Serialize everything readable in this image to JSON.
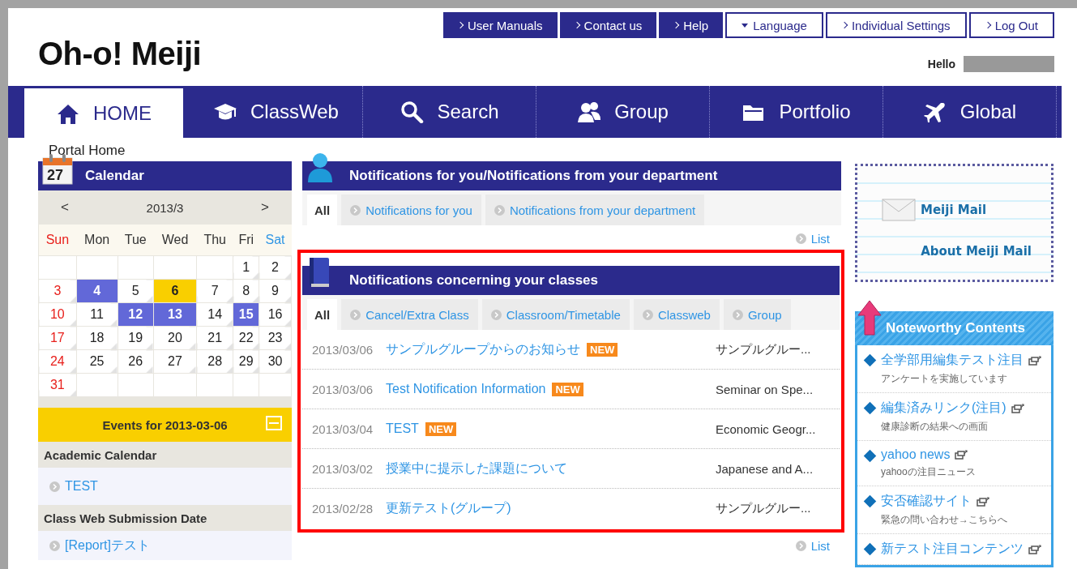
{
  "header": {
    "logo": "Oh-o! Meiji",
    "top_links": [
      {
        "label": "User Manuals",
        "kind": "link"
      },
      {
        "label": "Contact us",
        "kind": "link"
      },
      {
        "label": "Help",
        "kind": "link"
      },
      {
        "label": "Language",
        "kind": "dropdown"
      },
      {
        "label": "Individual Settings",
        "kind": "link"
      },
      {
        "label": "Log Out",
        "kind": "link"
      }
    ],
    "greeting": "Hello"
  },
  "nav": [
    {
      "label": "HOME",
      "selected": true
    },
    {
      "label": "ClassWeb",
      "selected": false
    },
    {
      "label": "Search",
      "selected": false
    },
    {
      "label": "Group",
      "selected": false
    },
    {
      "label": "Portfolio",
      "selected": false
    },
    {
      "label": "Global",
      "selected": false
    }
  ],
  "breadcrumb": "Portal Home",
  "calendar": {
    "icon_day": "27",
    "title": "Calendar",
    "prev": "<",
    "month": "2013/3",
    "next": ">",
    "weekdays": [
      "Sun",
      "Mon",
      "Tue",
      "Wed",
      "Thu",
      "Fri",
      "Sat"
    ],
    "weeks": [
      [
        {
          "kind": "blank"
        },
        {
          "kind": "blank"
        },
        {
          "kind": "blank"
        },
        {
          "kind": "blank"
        },
        {
          "kind": "blank"
        },
        {
          "kind": "day",
          "day": "1",
          "has_event": false,
          "selected": false
        },
        {
          "kind": "day",
          "day": "2",
          "has_event": false,
          "selected": false
        }
      ],
      [
        {
          "kind": "day",
          "day": "3",
          "has_event": false,
          "selected": false
        },
        {
          "kind": "day",
          "day": "4",
          "has_event": true,
          "selected": false
        },
        {
          "kind": "day",
          "day": "5",
          "has_event": false,
          "selected": false
        },
        {
          "kind": "day",
          "day": "6",
          "has_event": true,
          "selected": true
        },
        {
          "kind": "day",
          "day": "7",
          "has_event": false,
          "selected": false
        },
        {
          "kind": "day",
          "day": "8",
          "has_event": false,
          "selected": false
        },
        {
          "kind": "day",
          "day": "9",
          "has_event": false,
          "selected": false
        }
      ],
      [
        {
          "kind": "day",
          "day": "10",
          "has_event": false,
          "selected": false
        },
        {
          "kind": "day",
          "day": "11",
          "has_event": false,
          "selected": false
        },
        {
          "kind": "day",
          "day": "12",
          "has_event": true,
          "selected": false
        },
        {
          "kind": "day",
          "day": "13",
          "has_event": true,
          "selected": false
        },
        {
          "kind": "day",
          "day": "14",
          "has_event": false,
          "selected": false
        },
        {
          "kind": "day",
          "day": "15",
          "has_event": true,
          "selected": false
        },
        {
          "kind": "day",
          "day": "16",
          "has_event": false,
          "selected": false
        }
      ],
      [
        {
          "kind": "day",
          "day": "17",
          "has_event": false,
          "selected": false
        },
        {
          "kind": "day",
          "day": "18",
          "has_event": false,
          "selected": false
        },
        {
          "kind": "day",
          "day": "19",
          "has_event": false,
          "selected": false
        },
        {
          "kind": "day",
          "day": "20",
          "has_event": false,
          "selected": false
        },
        {
          "kind": "day",
          "day": "21",
          "has_event": false,
          "selected": false
        },
        {
          "kind": "day",
          "day": "22",
          "has_event": false,
          "selected": false
        },
        {
          "kind": "day",
          "day": "23",
          "has_event": false,
          "selected": false
        }
      ],
      [
        {
          "kind": "day",
          "day": "24",
          "has_event": false,
          "selected": false
        },
        {
          "kind": "day",
          "day": "25",
          "has_event": false,
          "selected": false
        },
        {
          "kind": "day",
          "day": "26",
          "has_event": false,
          "selected": false
        },
        {
          "kind": "day",
          "day": "27",
          "has_event": false,
          "selected": false
        },
        {
          "kind": "day",
          "day": "28",
          "has_event": false,
          "selected": false
        },
        {
          "kind": "day",
          "day": "29",
          "has_event": false,
          "selected": false
        },
        {
          "kind": "day",
          "day": "30",
          "has_event": false,
          "selected": false
        }
      ],
      [
        {
          "kind": "day",
          "day": "31",
          "has_event": false,
          "selected": false
        },
        {
          "kind": "blank"
        },
        {
          "kind": "blank"
        },
        {
          "kind": "blank"
        },
        {
          "kind": "blank"
        },
        {
          "kind": "blank"
        },
        {
          "kind": "blank"
        }
      ]
    ],
    "events": {
      "title": "Events for 2013-03-06",
      "expanded": true,
      "groups": [
        {
          "heading": "Academic Calendar",
          "items": [
            "TEST"
          ]
        },
        {
          "heading": "Class Web Submission Date",
          "items": [
            "[Report]テスト"
          ]
        }
      ]
    }
  },
  "notifications_personal": {
    "title": "Notifications for you/Notifications from your department",
    "tabs": [
      {
        "label": "All",
        "selected": true
      },
      {
        "label": "Notifications for you",
        "selected": false
      },
      {
        "label": "Notifications from your department",
        "selected": false
      }
    ],
    "list_link": "List"
  },
  "notifications_classes": {
    "title": "Notifications concerning your classes",
    "highlighted": true,
    "tabs": [
      {
        "label": "All",
        "selected": true
      },
      {
        "label": "Cancel/Extra Class",
        "selected": false
      },
      {
        "label": "Classroom/Timetable",
        "selected": false
      },
      {
        "label": "Classweb",
        "selected": false
      },
      {
        "label": "Group",
        "selected": false
      }
    ],
    "rows": [
      {
        "date": "2013/03/06",
        "title": "サンプルグループからのお知らせ",
        "badge": "NEW",
        "source": "サンプルグルー..."
      },
      {
        "date": "2013/03/06",
        "title": "Test Notification Information",
        "badge": "NEW",
        "source": "Seminar on Spe..."
      },
      {
        "date": "2013/03/04",
        "title": "TEST",
        "badge": "NEW",
        "source": "Economic Geogr..."
      },
      {
        "date": "2013/03/02",
        "title": "授業中に提示した課題について",
        "source": "Japanese and A..."
      },
      {
        "date": "2013/02/28",
        "title": "更新テスト(グループ)",
        "source": "サンプルグルー..."
      }
    ],
    "list_link": "List"
  },
  "mail": {
    "title": "Meiji Mail",
    "about": "About Meiji Mail"
  },
  "noteworthy": {
    "title": "Noteworthy Contents",
    "items": [
      {
        "title": "全学部用編集テスト注目",
        "subtitle": "アンケートを実施しています"
      },
      {
        "title": "編集済みリンク(注目)",
        "subtitle": "健康診断の結果への画面"
      },
      {
        "title": "yahoo news",
        "subtitle": "yahooの注目ニュース"
      },
      {
        "title": "安否確認サイト",
        "subtitle": "緊急の問い合わせ→こちらへ"
      },
      {
        "title": "新テスト注目コンテンツ"
      }
    ]
  }
}
